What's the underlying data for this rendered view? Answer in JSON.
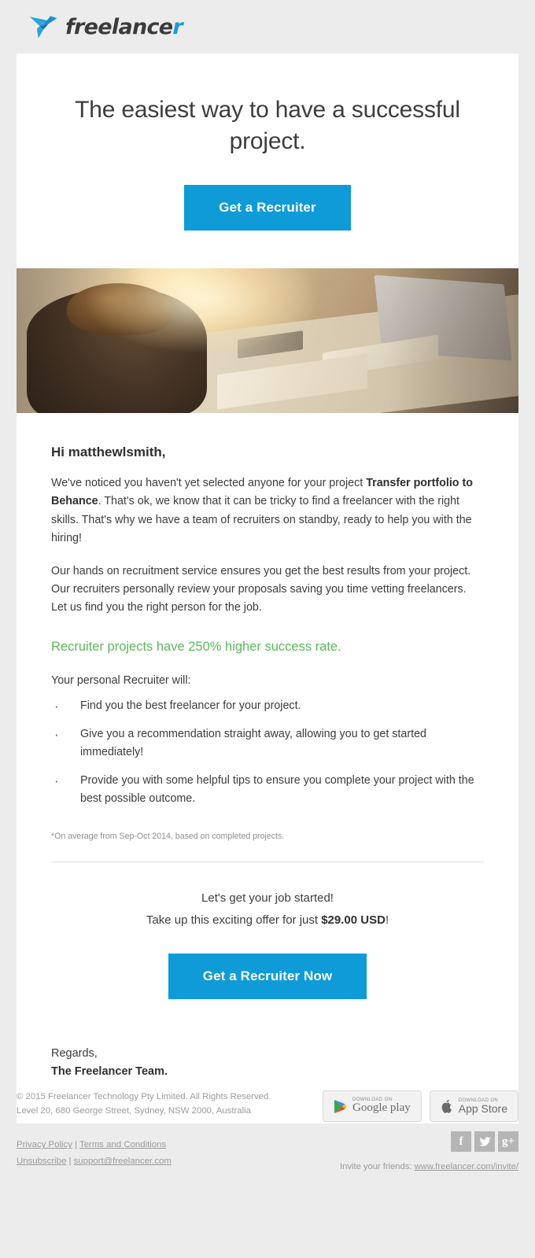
{
  "brand": {
    "name_main": "freelance",
    "name_tail": "r",
    "logo_icon": "freelancer-hummingbird-logo"
  },
  "hero": {
    "headline": "The easiest way to have a successful project.",
    "cta_label": "Get a Recruiter"
  },
  "hero_image": {
    "alt": "woman working at a desk with computer and notebook"
  },
  "body": {
    "greeting": "Hi matthewlsmith,",
    "para1_before": "We've noticed you haven't yet selected anyone for your project ",
    "para1_project": "Transfer portfolio to Behance",
    "para1_after": ". That's ok, we know that it can be tricky to find a freelancer with the right skills. That's why we have a team of recruiters on standby, ready to help you with the hiring!",
    "para2": "Our hands on recruitment service ensures you get the best results from your project. Our recruiters personally review your proposals saving you time vetting freelancers. Let us find you the right person for the job.",
    "highlight": "Recruiter projects have 250% higher success rate.",
    "list_lead": "Your personal Recruiter will:",
    "bullets": [
      "Find you the best freelancer for your project.",
      "Give you a recommendation straight away, allowing you to get started immediately!",
      "Provide you with some helpful tips to ensure you complete your project with the best possible outcome."
    ],
    "footnote": "*On average from Sep-Oct 2014, based on completed projects."
  },
  "offer": {
    "line1": "Let's get your job started!",
    "line2_before": "Take up this exciting offer for just ",
    "price": "$29.00 USD",
    "line2_after": "!",
    "cta_label": "Get a Recruiter Now"
  },
  "signoff": {
    "line1": "Regards,",
    "line2": "The Freelancer Team."
  },
  "footer": {
    "copyright": "© 2015 Freelancer Technology Pty Limited. All Rights Reserved.",
    "address": "Level 20, 680 George Street, Sydney, NSW 2000, Australia",
    "privacy_label": "Privacy Policy",
    "separator": " | ",
    "terms_label": "Terms and Conditions",
    "unsubscribe_label": "Unsubscribe",
    "support_label": "support@freelancer.com",
    "google_play": {
      "small": "DOWNLOAD ON",
      "big": "Google play",
      "icon": "google-play-icon"
    },
    "app_store": {
      "small": "DOWNLOAD ON",
      "big": "App Store",
      "icon": "apple-icon"
    },
    "socials": [
      {
        "name": "facebook-icon",
        "glyph": "f"
      },
      {
        "name": "twitter-icon",
        "glyph": "✈"
      },
      {
        "name": "google-plus-icon",
        "glyph": "g+"
      }
    ],
    "invite_text": "Invite your friends: ",
    "invite_link": "www.freelancer.com/invite/"
  },
  "colors": {
    "accent_blue": "#0e9bd8",
    "success_green": "#5cb85c",
    "page_bg": "#ececec",
    "muted": "#9b9b9b"
  }
}
